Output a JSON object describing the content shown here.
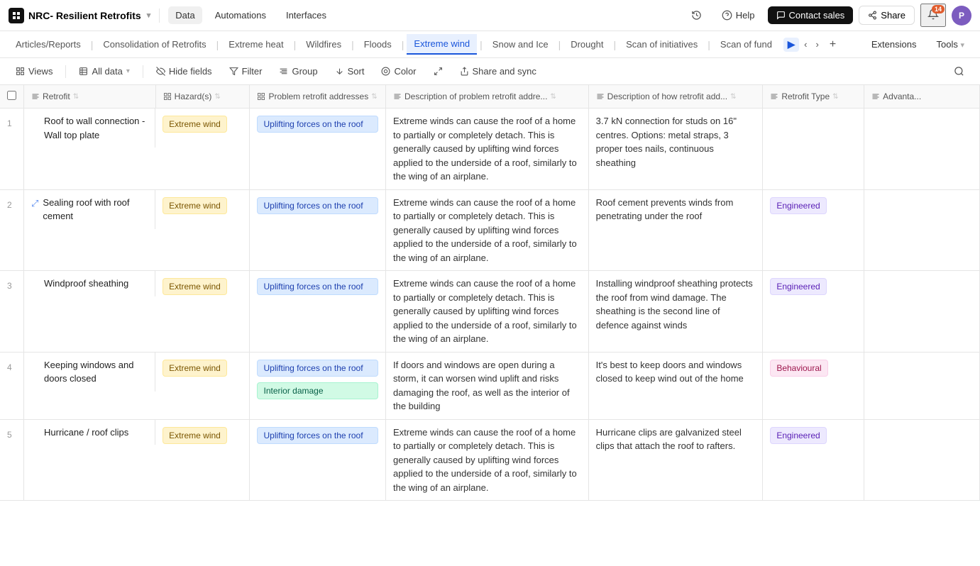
{
  "app": {
    "logo_text": "NRC- Resilient Retrofits",
    "nav_items": [
      "Data",
      "Automations",
      "Interfaces"
    ],
    "active_nav": "Data"
  },
  "nav_right": {
    "history_label": "",
    "help_label": "Help",
    "contact_sales_label": "Contact sales",
    "share_label": "Share",
    "notifications_count": "14",
    "avatar_letter": "P"
  },
  "tabs": [
    {
      "label": "Articles/Reports",
      "active": false
    },
    {
      "label": "Consolidation of Retrofits",
      "active": false
    },
    {
      "label": "Extreme heat",
      "active": false
    },
    {
      "label": "Wildfires",
      "active": false
    },
    {
      "label": "Floods",
      "active": false
    },
    {
      "label": "Extreme wind",
      "active": true
    },
    {
      "label": "Snow and Ice",
      "active": false
    },
    {
      "label": "Drought",
      "active": false
    },
    {
      "label": "Scan of initiatives",
      "active": false
    },
    {
      "label": "Scan of fund",
      "active": false
    }
  ],
  "tab_ext": {
    "extensions_label": "Extensions",
    "tools_label": "Tools"
  },
  "toolbar": {
    "views_label": "Views",
    "all_data_label": "All data",
    "hide_fields_label": "Hide fields",
    "filter_label": "Filter",
    "group_label": "Group",
    "sort_label": "Sort",
    "color_label": "Color",
    "share_sync_label": "Share and sync"
  },
  "columns": [
    {
      "id": "num",
      "label": ""
    },
    {
      "id": "retrofit",
      "label": "Retrofit",
      "icon": "text-icon"
    },
    {
      "id": "hazard",
      "label": "Hazard(s)",
      "icon": "multi-icon"
    },
    {
      "id": "problem",
      "label": "Problem retrofit addresses",
      "icon": "multi-icon"
    },
    {
      "id": "desc_prob",
      "label": "Description of problem retrofit addre...",
      "icon": "text-icon"
    },
    {
      "id": "desc_how",
      "label": "Description of how retrofit add...",
      "icon": "text-icon"
    },
    {
      "id": "type",
      "label": "Retrofit Type",
      "icon": "text-icon"
    },
    {
      "id": "advantage",
      "label": "Advanta...",
      "icon": "text-icon"
    }
  ],
  "rows": [
    {
      "num": "1",
      "retrofit": "Roof to wall connection - Wall top plate",
      "hazard": "Extreme wind",
      "problems": [
        "Uplifting forces on the roof"
      ],
      "desc_prob": "Extreme winds can cause the roof of a home to partially or completely detach. This is generally caused by uplifting wind forces applied to the underside of a roof, similarly to the wing of an airplane.",
      "desc_how": "3.7 kN connection for studs on 16\" centres. Options: metal straps, 3 proper toes nails, continuous sheathing",
      "type": "",
      "type_tag": "",
      "expanded": false
    },
    {
      "num": "2",
      "retrofit": "Sealing roof with roof cement",
      "hazard": "Extreme wind",
      "problems": [
        "Uplifting forces on the roof"
      ],
      "desc_prob": "Extreme winds can cause the roof of a home to partially or completely detach. This is generally caused by uplifting wind forces applied to the underside of a roof, similarly to the wing of an airplane.",
      "desc_how": "Roof cement prevents winds from penetrating under the roof",
      "type": "Engineered",
      "type_tag": "engineered",
      "expanded": true
    },
    {
      "num": "3",
      "retrofit": "Windproof sheathing",
      "hazard": "Extreme wind",
      "problems": [
        "Uplifting forces on the roof"
      ],
      "desc_prob": "Extreme winds can cause the roof of a home to partially or completely detach. This is generally caused by uplifting wind forces applied to the underside of a roof, similarly to the wing of an airplane.",
      "desc_how": "Installing windproof sheathing protects the roof from wind damage. The sheathing is the second line of defence against winds",
      "type": "Engineered",
      "type_tag": "engineered",
      "expanded": false
    },
    {
      "num": "4",
      "retrofit": "Keeping windows and doors closed",
      "hazard": "Extreme wind",
      "problems": [
        "Uplifting forces on the roof",
        "Interior damage"
      ],
      "desc_prob": "If doors and windows are open during a storm, it can worsen wind uplift and risks damaging the roof, as well as the interior of the building",
      "desc_how": "It's best to keep doors and windows closed to keep wind out of the home",
      "type": "Behavioural",
      "type_tag": "behavioural",
      "expanded": false
    },
    {
      "num": "5",
      "retrofit": "Hurricane / roof clips",
      "hazard": "Extreme wind",
      "problems": [
        "Uplifting forces on the roof"
      ],
      "desc_prob": "Extreme winds can cause the roof of a home to partially or completely detach. This is generally caused by uplifting wind forces applied to the underside of a roof, similarly to the wing of an airplane.",
      "desc_how": "Hurricane clips are galvanized steel clips that attach the roof to rafters.",
      "type": "Engineered",
      "type_tag": "engineered",
      "expanded": false
    }
  ]
}
